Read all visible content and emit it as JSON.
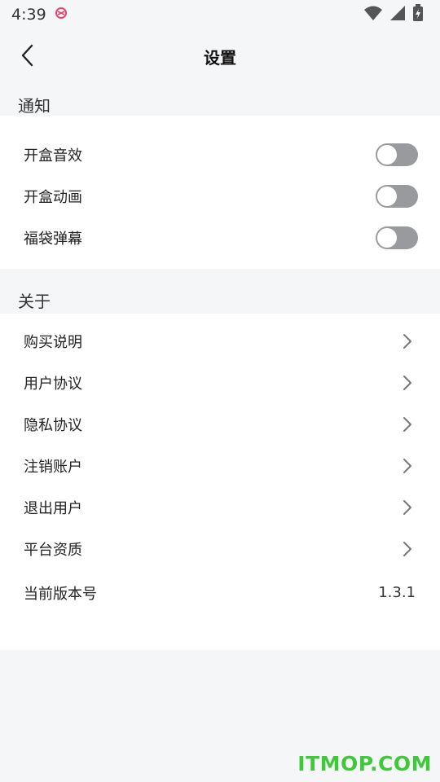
{
  "status_bar": {
    "time": "4:39",
    "app_icon": "notification-app-icon",
    "icons": [
      "wifi-icon",
      "signal-icon",
      "battery-charging-icon"
    ]
  },
  "nav": {
    "title": "设置",
    "back_icon": "chevron-left-icon"
  },
  "notify_section": {
    "header": "通知",
    "items": [
      {
        "label": "开盒音效",
        "enabled": false
      },
      {
        "label": "开盒动画",
        "enabled": false
      },
      {
        "label": "福袋弹幕",
        "enabled": false
      }
    ]
  },
  "about_section": {
    "header": "关于",
    "items": [
      {
        "label": "购买说明"
      },
      {
        "label": "用户协议"
      },
      {
        "label": "隐私协议"
      },
      {
        "label": "注销账户"
      },
      {
        "label": "退出用户"
      },
      {
        "label": "平台资质"
      }
    ],
    "version": {
      "label": "当前版本号",
      "value": "1.3.1"
    }
  },
  "watermark": "ITMOP.COM",
  "colors": {
    "page_bg": "#f5f6f8",
    "card_bg": "#ffffff",
    "toggle_off": "#999a9e",
    "watermark": "#3fc93a"
  }
}
